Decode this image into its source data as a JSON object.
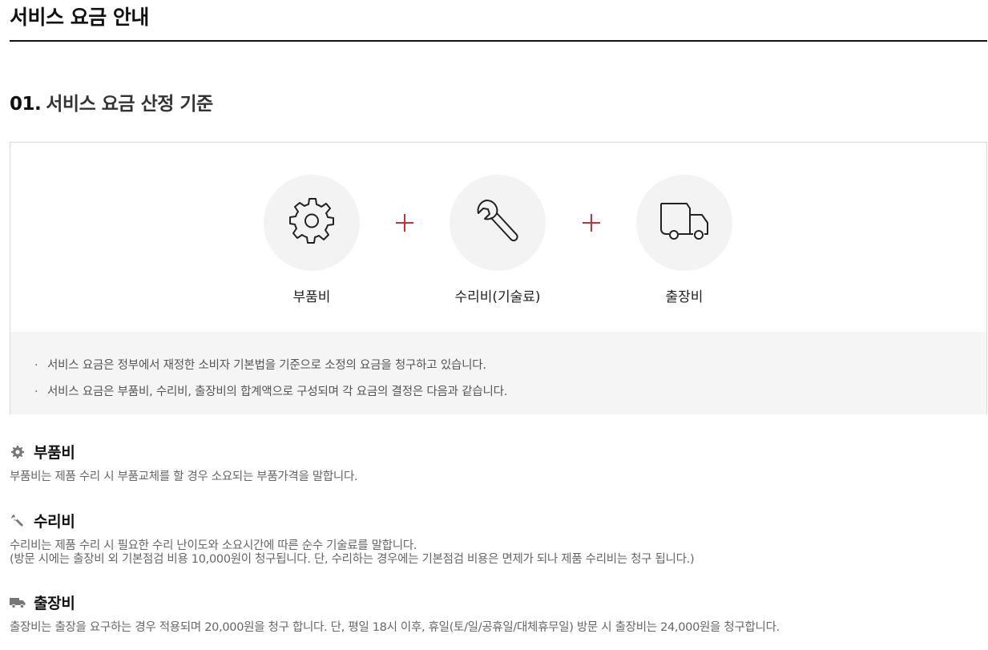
{
  "page": {
    "title": "서비스 요금 안내"
  },
  "section": {
    "number": "01.",
    "title": "서비스 요금 산정 기준"
  },
  "fees": [
    {
      "label": "부품비",
      "icon": "gear-icon"
    },
    {
      "label": "수리비(기술료)",
      "icon": "wrench-icon"
    },
    {
      "label": "출장비",
      "icon": "truck-icon"
    }
  ],
  "colors": {
    "accent": "#c9303a",
    "circle_bg": "#f3f3f3",
    "note_bg": "#f5f5f5"
  },
  "notes": [
    "서비스 요금은 정부에서 재정한 소비자 기본법을 기준으로 소정의 요금을 청구하고 있습니다.",
    "서비스 요금은 부품비, 수리비, 출장비의 합계액으로 구성되며 각 요금의 결정은 다음과 같습니다."
  ],
  "details": {
    "parts": {
      "title": "부품비",
      "text": "부품비는 제품 수리 시 부품교체를 할 경우 소요되는 부품가격을 말합니다."
    },
    "repair": {
      "title": "수리비",
      "text1": "수리비는 제품 수리 시 필요한 수리 난이도와 소요시간에 따른 순수 기술료를 말합니다.",
      "text2": "(방문 시에는 출장비 외 기본점검 비용 10,000원이 청구됩니다. 단, 수리하는 경우에는 기본점검 비용은 면제가 되나 제품 수리비는 청구 됩니다.)"
    },
    "travel": {
      "title": "출장비",
      "text": "출장비는 출장을 요구하는 경우 적용되며 20,000원을 청구 합니다. 단, 평일 18시 이후, 휴일(토/일/공휴일/대체휴무일) 방문 시 출장비는 24,000원을 청구합니다."
    }
  }
}
